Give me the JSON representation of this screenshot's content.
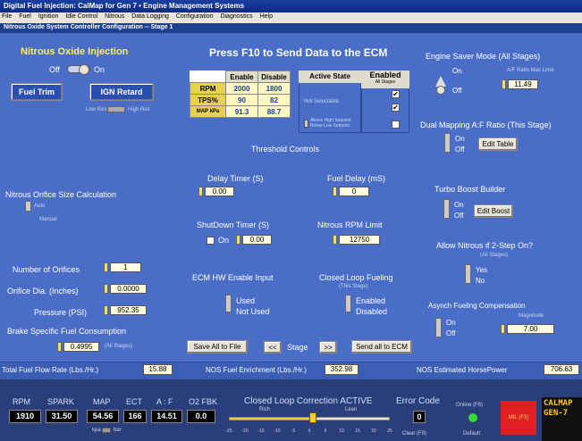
{
  "window": {
    "title": "Digital Fuel Injection: CalMap for Gen 7 • Engine Management Systems",
    "menu": [
      "File",
      "Fuel",
      "Ignition",
      "Idle Control",
      "Nitrous",
      "Data Logging",
      "Configuration",
      "Diagnostics",
      "Help"
    ],
    "subtitle": "Nitrous Oxide System Controller Configuration -- Stage 1"
  },
  "nitrous": {
    "title": "Nitrous Oxide Injection",
    "off": "Off",
    "on": "On",
    "fuel_trim": "Fuel Trim",
    "ign_retard": "IGN Retard",
    "low_res": "Low Res",
    "high_res": "High Res"
  },
  "header": {
    "press_f10": "Press F10 to Send Data to the ECM"
  },
  "table": {
    "col_enable": "Enable",
    "col_disable": "Disable",
    "rows": [
      {
        "label": "RPM",
        "enable": "2000",
        "disable": "1800"
      },
      {
        "label": "TPS%",
        "enable": "90",
        "disable": "82"
      },
      {
        "label": "MAP kPa",
        "enable": "91.3",
        "disable": "88.7"
      }
    ],
    "active_state": "Active State",
    "enabled": "Enabled",
    "all_stages": "All Stages",
    "not_selectable": "Not Selectable",
    "above_below": "Above High Setpoint\nBelow Low Setpoint",
    "threshold_controls": "Threshold Controls"
  },
  "orifice": {
    "title": "Nitrous Orifice Size Calculation",
    "auto": "Auto",
    "manual": "Manual",
    "num_orifices_label": "Number of Orifices",
    "num_orifices": "1",
    "dia_label": "Orifice Dia. (Inches)",
    "dia": "0.0000",
    "pressure_label": "Pressure (PSI)",
    "pressure": "952.35",
    "bsfc_label": "Brake Specific Fuel Consumption",
    "bsfc": "0.4995",
    "all_stages": "(All Stages)"
  },
  "timers": {
    "delay_label": "Delay Timer (S)",
    "delay": "0.00",
    "fuel_delay_label": "Fuel Delay (mS)",
    "fuel_delay": "0",
    "shutdown_label": "ShutDown Timer (S)",
    "shutdown_on": "On",
    "shutdown": "0.00",
    "rpm_limit_label": "Nitrous RPM Limit",
    "rpm_limit": "12750"
  },
  "ecm_hw": {
    "label": "ECM HW Enable Input",
    "used": "Used",
    "not_used": "Not Used"
  },
  "closed_loop": {
    "label": "Closed Loop Fueling",
    "sub": "(This Stage)",
    "enabled": "Enabled",
    "disabled": "Disabled"
  },
  "buttons": {
    "save_all": "Save All to File",
    "prev": "<<",
    "stage": "Stage",
    "next": ">>",
    "send_all": "Send all to ECM"
  },
  "engine_saver": {
    "title": "Engine Saver Mode (All Stages)",
    "on": "On",
    "off": "Off",
    "af_max_label": "A/F Ratio Max Limit",
    "af_max": "11.49"
  },
  "dual_map": {
    "title": "Dual Mapping A:F Ratio (This Stage)",
    "on": "On",
    "off": "Off",
    "edit": "Edit Table"
  },
  "turbo": {
    "title": "Turbo Boost Builder",
    "on": "On",
    "off": "Off",
    "edit": "Edit Boost"
  },
  "two_step": {
    "title": "Allow Nitrous if 2-Step On?",
    "sub": "(All Stages)",
    "yes": "Yes",
    "no": "No"
  },
  "asynch": {
    "title": "Asynch Fueling Compensation",
    "magnitude": "Magnitude",
    "on": "On",
    "off": "Off",
    "value": "7.00"
  },
  "status": {
    "fuel_flow_label": "Total Fuel Flow Rate (Lbs./Hr.)",
    "fuel_flow": "15.88",
    "nos_fuel_label": "NOS Fuel Enrichment (Lbs./Hr.)",
    "nos_fuel": "352.98",
    "nos_hp_label": "NOS Estimated HorsePower",
    "nos_hp": "706.63"
  },
  "gauges": {
    "headers": [
      "RPM",
      "SPARK",
      "MAP",
      "ECT",
      "A : F",
      "O2 FBK"
    ],
    "values": [
      "1910",
      "31.50",
      "54.56",
      "166",
      "14.51",
      "0.0"
    ],
    "kpa": "kpa",
    "bar": "bar",
    "closed_loop_title": "Closed Loop Correction ACTIVE",
    "rich": "Rich",
    "lean": "Lean",
    "scale": [
      "-25",
      "-20",
      "-15",
      "-10",
      "-5",
      "0",
      "5",
      "10",
      "15",
      "20",
      "25"
    ],
    "slider_position": 0.52,
    "error_label": "Error Code",
    "error_value": "0",
    "clear": "Clear (F9)",
    "online": "Online (F8)",
    "default": "Default",
    "mil": "MIL (F3)",
    "logo": "CALMAP GEN-7",
    "accent_red": "#e02020",
    "led_green": "#35d835"
  }
}
